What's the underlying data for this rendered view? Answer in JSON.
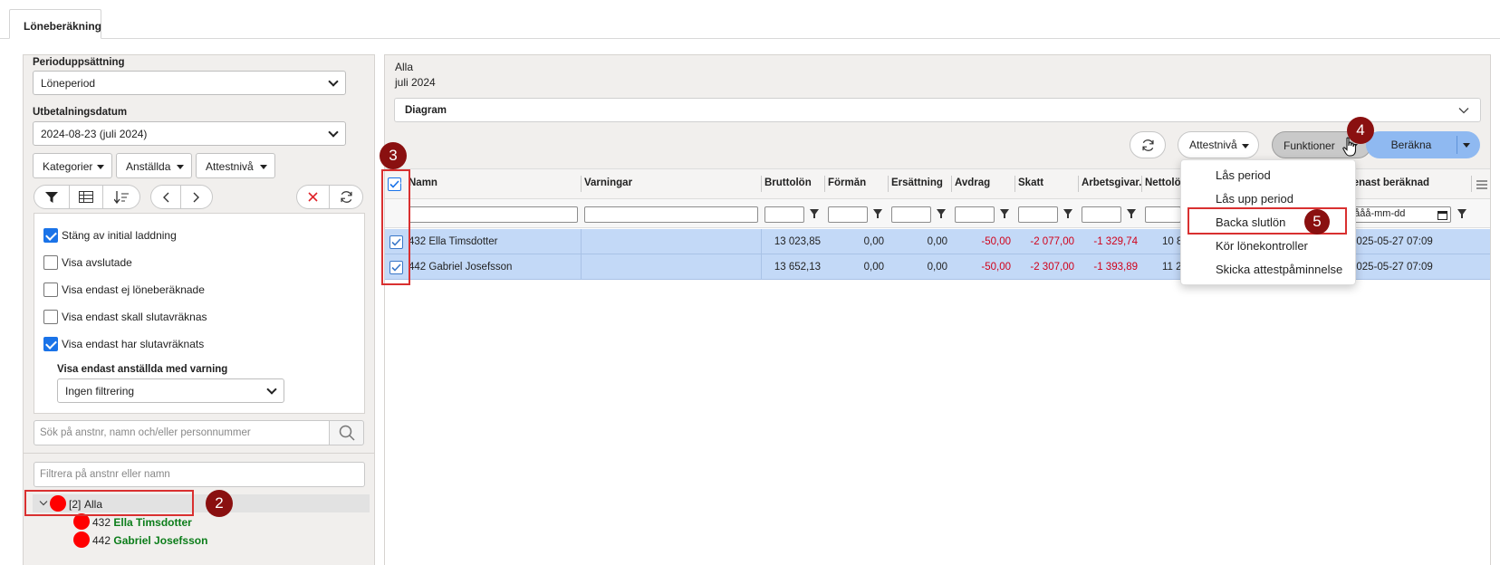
{
  "tab": {
    "label": "Löneberäkning"
  },
  "left": {
    "period_setup_label": "Perioduppsättning",
    "period_setup_value": "Löneperiod",
    "payment_date_label": "Utbetalningsdatum",
    "payment_date_value": "2024-08-23 (juli 2024)",
    "filters": {
      "categories": "Kategorier",
      "employees": "Anställda",
      "attest": "Attestnivå"
    },
    "checkboxes": [
      {
        "label": "Stäng av initial laddning",
        "checked": true
      },
      {
        "label": "Visa avslutade",
        "checked": false
      },
      {
        "label": "Visa endast ej löneberäknade",
        "checked": false
      },
      {
        "label": "Visa endast skall slutavräknas",
        "checked": false
      },
      {
        "label": "Visa endast har slutavräknats",
        "checked": true
      }
    ],
    "warning_label": "Visa endast anställda med varning",
    "warning_value": "Ingen filtrering",
    "search_placeholder": "Sök på anstnr, namn och/eller personnummer",
    "filter_placeholder": "Filtrera på anstnr eller namn",
    "tree": {
      "root_count": "[2]",
      "root_label": "Alla",
      "employees": [
        {
          "number": "432",
          "name": "Ella Timsdotter"
        },
        {
          "number": "442",
          "name": "Gabriel Josefsson"
        }
      ]
    }
  },
  "right": {
    "header_line1": "Alla",
    "header_line2": "juli 2024",
    "diagram_label": "Diagram",
    "attest_button": "Attestnivå",
    "functions_button": "Funktioner",
    "calculate_button": "Beräkna",
    "columns": {
      "name": "Namn",
      "warnings": "Varningar",
      "gross": "Bruttolön",
      "benefit": "Förmån",
      "compensation": "Ersättning",
      "deduction": "Avdrag",
      "tax": "Skatt",
      "employer": "Arbetsgivar...",
      "net": "Nettolön",
      "last_calc": "Senast beräknad"
    },
    "date_filter_placeholder": "åååå-mm-dd",
    "rows": [
      {
        "name": "432 Ella Timsdotter",
        "gross": "13 023,85",
        "benefit": "0,00",
        "compensation": "0,00",
        "deduction": "-50,00",
        "tax": "-2 077,00",
        "employer": "-1 329,74",
        "net": "10 8",
        "last_calc": "2025-05-27 07:09"
      },
      {
        "name": "442 Gabriel Josefsson",
        "gross": "13 652,13",
        "benefit": "0,00",
        "compensation": "0,00",
        "deduction": "-50,00",
        "tax": "-2 307,00",
        "employer": "-1 393,89",
        "net": "11 2",
        "last_calc": "2025-05-27 07:09"
      }
    ],
    "menu": [
      "Lås period",
      "Lås upp period",
      "Backa slutlön",
      "Kör lönekontroller",
      "Skicka attestpåminnelse"
    ]
  },
  "badges": {
    "b2": "2",
    "b3": "3",
    "b4": "4",
    "b5": "5"
  },
  "colors": {
    "accent": "#1a73e8",
    "row_selected": "#c3d9f7",
    "negative": "#d0021b",
    "badge": "#8a1010",
    "highlight": "#d93030",
    "employee_name": "#0c7d1a"
  }
}
